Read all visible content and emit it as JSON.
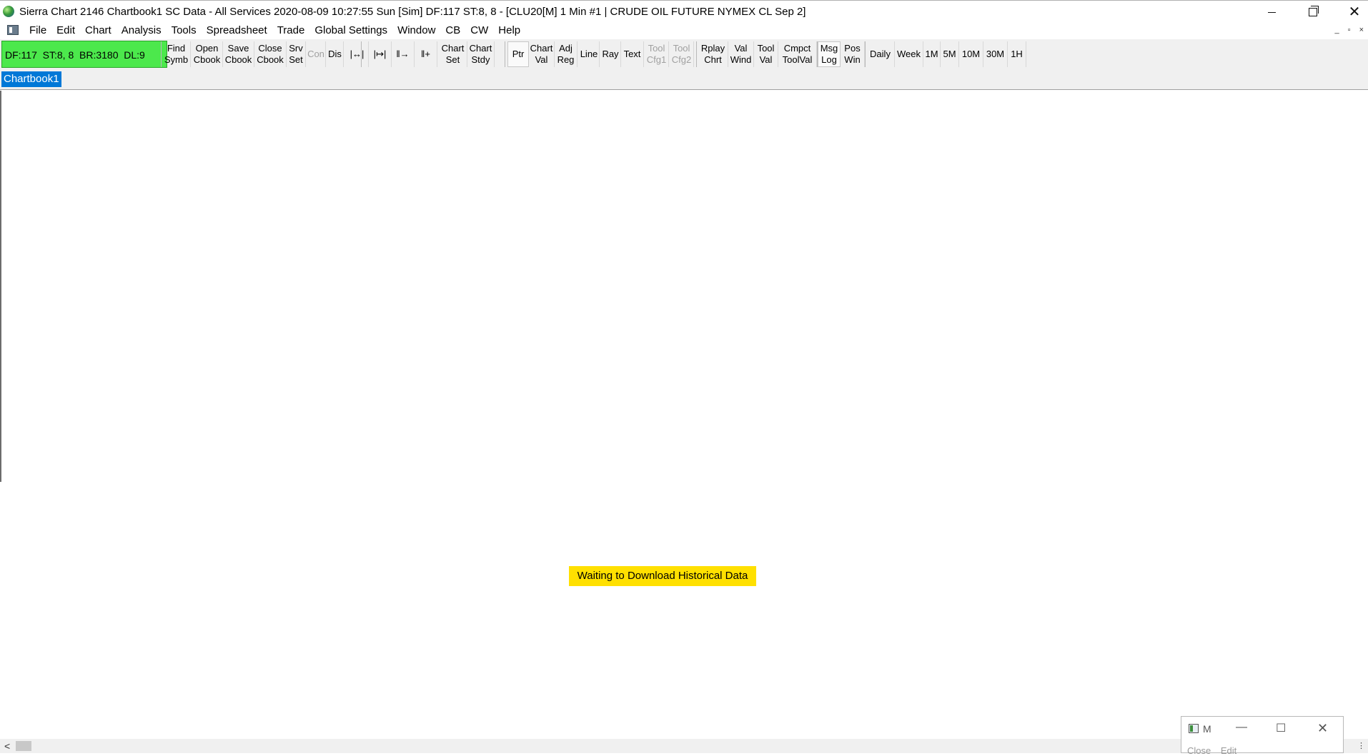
{
  "window": {
    "title": "Sierra Chart 2146 Chartbook1  SC Data - All Services 2020-08-09  10:27:55 Sun [Sim]  DF:117  ST:8, 8 - [CLU20[M]  1 Min  #1 | CRUDE OIL FUTURE NYMEX CL Sep 2]",
    "minimize_glyph": "minimize-icon",
    "restore_glyph": "restore-icon",
    "close_glyph": "✕"
  },
  "menu": {
    "items": [
      "File",
      "Edit",
      "Chart",
      "Analysis",
      "Tools",
      "Spreadsheet",
      "Trade",
      "Global Settings",
      "Window",
      "CB",
      "CW",
      "Help"
    ],
    "mdi_controls": [
      "_",
      "▫",
      "×"
    ]
  },
  "toolbar": {
    "status": "DF:117  ST:8, 8  BR:3180  DL:9",
    "status_color": "#4ce84c",
    "buttons": [
      {
        "l1": "Find",
        "l2": "Symb",
        "disabled": false
      },
      {
        "l1": "Open",
        "l2": "Cbook",
        "disabled": false
      },
      {
        "l1": "Save",
        "l2": "Cbook",
        "disabled": false
      },
      {
        "l1": "Close",
        "l2": "Cbook",
        "disabled": false
      },
      {
        "l1": "Srv",
        "l2": "Set",
        "disabled": false
      },
      {
        "l1": "Con",
        "l2": "",
        "disabled": true
      },
      {
        "l1": "Dis",
        "l2": "",
        "disabled": false
      },
      {
        "l1": "|↔|",
        "l2": "",
        "disabled": false
      },
      {
        "l1": "|↦|",
        "l2": "",
        "disabled": false
      },
      {
        "l1": "‖→",
        "l2": "",
        "disabled": false
      },
      {
        "l1": "‖+",
        "l2": "",
        "disabled": false
      },
      {
        "l1": "Chart",
        "l2": "Set",
        "disabled": false
      },
      {
        "l1": "Chart",
        "l2": "Stdy",
        "disabled": false
      },
      {
        "l1": "Ptr",
        "l2": "",
        "disabled": false,
        "active": true
      },
      {
        "l1": "Chart",
        "l2": "Val",
        "disabled": false
      },
      {
        "l1": "Adj",
        "l2": "Reg",
        "disabled": false
      },
      {
        "l1": "Line",
        "l2": "",
        "disabled": false
      },
      {
        "l1": "Ray",
        "l2": "",
        "disabled": false
      },
      {
        "l1": "Text",
        "l2": "",
        "disabled": false
      },
      {
        "l1": "Tool",
        "l2": "Cfg1",
        "disabled": true
      },
      {
        "l1": "Tool",
        "l2": "Cfg2",
        "disabled": true
      },
      {
        "l1": "Rplay",
        "l2": "Chrt",
        "disabled": false
      },
      {
        "l1": "Val",
        "l2": "Wind",
        "disabled": false
      },
      {
        "l1": "Tool",
        "l2": "Val",
        "disabled": false
      },
      {
        "l1": "Cmpct",
        "l2": "ToolVal",
        "disabled": false
      },
      {
        "l1": "Msg",
        "l2": "Log",
        "disabled": false,
        "active": true
      },
      {
        "l1": "Pos",
        "l2": "Win",
        "disabled": false
      },
      {
        "l1": "Daily",
        "l2": "",
        "disabled": false
      },
      {
        "l1": "Week",
        "l2": "",
        "disabled": false
      },
      {
        "l1": "1M",
        "l2": "",
        "disabled": false
      },
      {
        "l1": "5M",
        "l2": "",
        "disabled": false
      },
      {
        "l1": "10M",
        "l2": "",
        "disabled": false
      },
      {
        "l1": "30M",
        "l2": "",
        "disabled": false
      },
      {
        "l1": "1H",
        "l2": "",
        "disabled": false
      }
    ]
  },
  "tabs": {
    "active": "Chartbook1",
    "active_color": "#0078d7"
  },
  "chart": {
    "message": "Waiting to Download Historical Data",
    "message_color": "#ffe000"
  },
  "scrollbar": {
    "left_arrow": "<",
    "right_dots": "⋮"
  },
  "minimized_window": {
    "title": "M",
    "menu": [
      "Close",
      "Edit"
    ]
  }
}
